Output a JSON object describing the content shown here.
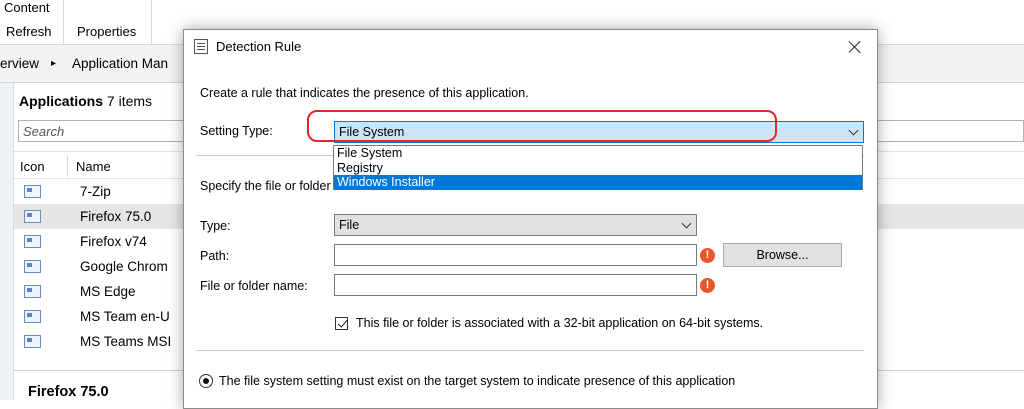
{
  "ribbon": {
    "content_label": "Content",
    "refresh_label": "Refresh",
    "properties_label": "Properties"
  },
  "breadcrumb": {
    "item1": "erview",
    "separator": "▸",
    "item2": "Application Man"
  },
  "list": {
    "title": "Applications",
    "count": "7 items",
    "search_placeholder": "Search",
    "columns": {
      "icon": "Icon",
      "name": "Name"
    },
    "rows": [
      {
        "name": "7-Zip"
      },
      {
        "name": "Firefox 75.0"
      },
      {
        "name": "Firefox v74"
      },
      {
        "name": "Google Chrom"
      },
      {
        "name": "MS Edge"
      },
      {
        "name": "MS Team en-U"
      },
      {
        "name": "MS Teams MSI"
      }
    ],
    "selected_index": 1
  },
  "details": {
    "title": "Firefox 75.0"
  },
  "dialog": {
    "title": "Detection Rule",
    "instruction": "Create a rule that indicates the presence of this application.",
    "setting_type_label": "Setting Type:",
    "setting_type_value": "File System",
    "setting_type_options": [
      "File System",
      "Registry",
      "Windows Installer"
    ],
    "highlighted_option_index": 2,
    "specify_text": "Specify the file or folder t",
    "type_label": "Type:",
    "type_value": "File",
    "path_label": "Path:",
    "path_value": "",
    "name_label": "File or folder name:",
    "name_value": "",
    "browse_label": "Browse...",
    "error_glyph": "!",
    "checkbox_label": "This file or folder is associated with a 32-bit application on 64-bit systems.",
    "checkbox_checked": true,
    "radio_label": "The file system setting must exist on the target system to indicate presence of this application",
    "radio_selected": true
  },
  "colors": {
    "accent": "#0078d7",
    "annotation": "#e0282b",
    "error": "#e8572a"
  }
}
